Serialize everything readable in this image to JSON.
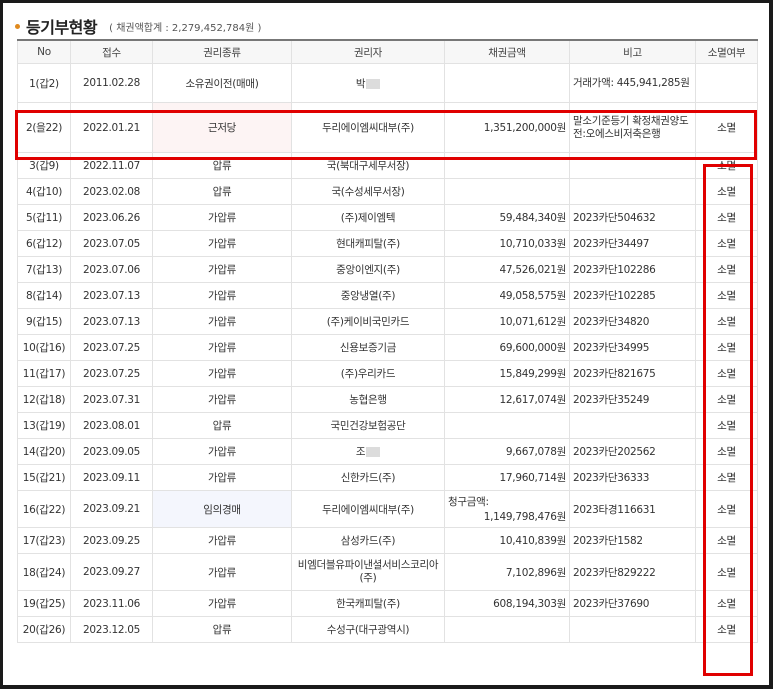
{
  "section": {
    "title": "등기부현황",
    "total": "( 채권액합계 : 2,279,452,784원 )"
  },
  "columns": [
    "No",
    "접수",
    "권리종류",
    "권리자",
    "채권금액",
    "비고",
    "소멸여부"
  ],
  "rows": [
    {
      "no": "1(갑2)",
      "date": "2011.02.28",
      "type": "소유권이전(매매)",
      "holder": "박",
      "amount": "",
      "note": "거래가액: 445,941,285원",
      "status": ""
    },
    {
      "no": "2(을22)",
      "date": "2022.01.21",
      "type": "근저당",
      "holder": "두리에이엠씨대부(주)",
      "amount": "1,351,200,000원",
      "note": "말소기준등기 확정채권양도 전:오에스비저축은행",
      "status": "소멸"
    },
    {
      "no": "3(갑9)",
      "date": "2022.11.07",
      "type": "압류",
      "holder": "국(북대구세무서장)",
      "amount": "",
      "note": "",
      "status": "소멸"
    },
    {
      "no": "4(갑10)",
      "date": "2023.02.08",
      "type": "압류",
      "holder": "국(수성세무서장)",
      "amount": "",
      "note": "",
      "status": "소멸"
    },
    {
      "no": "5(갑11)",
      "date": "2023.06.26",
      "type": "가압류",
      "holder": "(주)제이엠텍",
      "amount": "59,484,340원",
      "note": "2023카단504632",
      "status": "소멸"
    },
    {
      "no": "6(갑12)",
      "date": "2023.07.05",
      "type": "가압류",
      "holder": "현대캐피탈(주)",
      "amount": "10,710,033원",
      "note": "2023카단34497",
      "status": "소멸"
    },
    {
      "no": "7(갑13)",
      "date": "2023.07.06",
      "type": "가압류",
      "holder": "중앙이엔지(주)",
      "amount": "47,526,021원",
      "note": "2023카단102286",
      "status": "소멸"
    },
    {
      "no": "8(갑14)",
      "date": "2023.07.13",
      "type": "가압류",
      "holder": "중앙냉열(주)",
      "amount": "49,058,575원",
      "note": "2023카단102285",
      "status": "소멸"
    },
    {
      "no": "9(갑15)",
      "date": "2023.07.13",
      "type": "가압류",
      "holder": "(주)케이비국민카드",
      "amount": "10,071,612원",
      "note": "2023카단34820",
      "status": "소멸"
    },
    {
      "no": "10(갑16)",
      "date": "2023.07.25",
      "type": "가압류",
      "holder": "신용보증기금",
      "amount": "69,600,000원",
      "note": "2023카단34995",
      "status": "소멸"
    },
    {
      "no": "11(갑17)",
      "date": "2023.07.25",
      "type": "가압류",
      "holder": "(주)우리카드",
      "amount": "15,849,299원",
      "note": "2023카단821675",
      "status": "소멸"
    },
    {
      "no": "12(갑18)",
      "date": "2023.07.31",
      "type": "가압류",
      "holder": "농협은행",
      "amount": "12,617,074원",
      "note": "2023카단35249",
      "status": "소멸"
    },
    {
      "no": "13(갑19)",
      "date": "2023.08.01",
      "type": "압류",
      "holder": "국민건강보험공단",
      "amount": "",
      "note": "",
      "status": "소멸"
    },
    {
      "no": "14(갑20)",
      "date": "2023.09.05",
      "type": "가압류",
      "holder": "조",
      "amount": "9,667,078원",
      "note": "2023카단202562",
      "status": "소멸"
    },
    {
      "no": "15(갑21)",
      "date": "2023.09.11",
      "type": "가압류",
      "holder": "신한카드(주)",
      "amount": "17,960,714원",
      "note": "2023카단36333",
      "status": "소멸"
    },
    {
      "no": "16(갑22)",
      "date": "2023.09.21",
      "type": "임의경매",
      "holder": "두리에이엠씨대부(주)",
      "amount_label": "청구금액:",
      "amount": "1,149,798,476원",
      "note": "2023타경116631",
      "status": "소멸"
    },
    {
      "no": "17(갑23)",
      "date": "2023.09.25",
      "type": "가압류",
      "holder": "삼성카드(주)",
      "amount": "10,410,839원",
      "note": "2023카단1582",
      "status": "소멸"
    },
    {
      "no": "18(갑24)",
      "date": "2023.09.27",
      "type": "가압류",
      "holder": "비엠더블유파이낸셜서비스코리아(주)",
      "amount": "7,102,896원",
      "note": "2023카단829222",
      "status": "소멸"
    },
    {
      "no": "19(갑25)",
      "date": "2023.11.06",
      "type": "가압류",
      "holder": "한국캐피탈(주)",
      "amount": "608,194,303원",
      "note": "2023카단37690",
      "status": "소멸"
    },
    {
      "no": "20(갑26)",
      "date": "2023.12.05",
      "type": "압류",
      "holder": "수성구(대구광역시)",
      "amount": "",
      "note": "",
      "status": "소멸"
    }
  ]
}
